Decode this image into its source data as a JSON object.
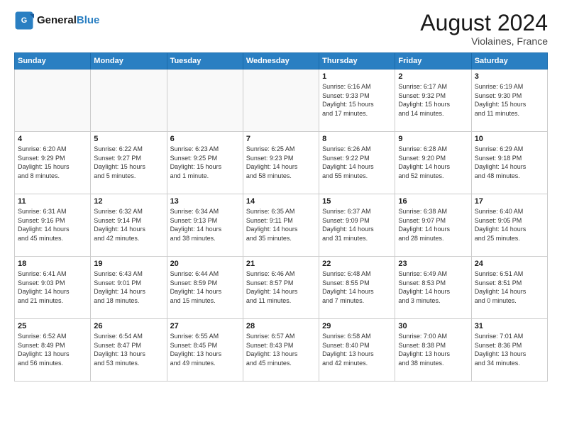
{
  "header": {
    "logo_line1": "General",
    "logo_line2": "Blue",
    "month_title": "August 2024",
    "location": "Violaines, France"
  },
  "days_of_week": [
    "Sunday",
    "Monday",
    "Tuesday",
    "Wednesday",
    "Thursday",
    "Friday",
    "Saturday"
  ],
  "weeks": [
    [
      {
        "day": "",
        "info": ""
      },
      {
        "day": "",
        "info": ""
      },
      {
        "day": "",
        "info": ""
      },
      {
        "day": "",
        "info": ""
      },
      {
        "day": "1",
        "info": "Sunrise: 6:16 AM\nSunset: 9:33 PM\nDaylight: 15 hours\nand 17 minutes."
      },
      {
        "day": "2",
        "info": "Sunrise: 6:17 AM\nSunset: 9:32 PM\nDaylight: 15 hours\nand 14 minutes."
      },
      {
        "day": "3",
        "info": "Sunrise: 6:19 AM\nSunset: 9:30 PM\nDaylight: 15 hours\nand 11 minutes."
      }
    ],
    [
      {
        "day": "4",
        "info": "Sunrise: 6:20 AM\nSunset: 9:29 PM\nDaylight: 15 hours\nand 8 minutes."
      },
      {
        "day": "5",
        "info": "Sunrise: 6:22 AM\nSunset: 9:27 PM\nDaylight: 15 hours\nand 5 minutes."
      },
      {
        "day": "6",
        "info": "Sunrise: 6:23 AM\nSunset: 9:25 PM\nDaylight: 15 hours\nand 1 minute."
      },
      {
        "day": "7",
        "info": "Sunrise: 6:25 AM\nSunset: 9:23 PM\nDaylight: 14 hours\nand 58 minutes."
      },
      {
        "day": "8",
        "info": "Sunrise: 6:26 AM\nSunset: 9:22 PM\nDaylight: 14 hours\nand 55 minutes."
      },
      {
        "day": "9",
        "info": "Sunrise: 6:28 AM\nSunset: 9:20 PM\nDaylight: 14 hours\nand 52 minutes."
      },
      {
        "day": "10",
        "info": "Sunrise: 6:29 AM\nSunset: 9:18 PM\nDaylight: 14 hours\nand 48 minutes."
      }
    ],
    [
      {
        "day": "11",
        "info": "Sunrise: 6:31 AM\nSunset: 9:16 PM\nDaylight: 14 hours\nand 45 minutes."
      },
      {
        "day": "12",
        "info": "Sunrise: 6:32 AM\nSunset: 9:14 PM\nDaylight: 14 hours\nand 42 minutes."
      },
      {
        "day": "13",
        "info": "Sunrise: 6:34 AM\nSunset: 9:13 PM\nDaylight: 14 hours\nand 38 minutes."
      },
      {
        "day": "14",
        "info": "Sunrise: 6:35 AM\nSunset: 9:11 PM\nDaylight: 14 hours\nand 35 minutes."
      },
      {
        "day": "15",
        "info": "Sunrise: 6:37 AM\nSunset: 9:09 PM\nDaylight: 14 hours\nand 31 minutes."
      },
      {
        "day": "16",
        "info": "Sunrise: 6:38 AM\nSunset: 9:07 PM\nDaylight: 14 hours\nand 28 minutes."
      },
      {
        "day": "17",
        "info": "Sunrise: 6:40 AM\nSunset: 9:05 PM\nDaylight: 14 hours\nand 25 minutes."
      }
    ],
    [
      {
        "day": "18",
        "info": "Sunrise: 6:41 AM\nSunset: 9:03 PM\nDaylight: 14 hours\nand 21 minutes."
      },
      {
        "day": "19",
        "info": "Sunrise: 6:43 AM\nSunset: 9:01 PM\nDaylight: 14 hours\nand 18 minutes."
      },
      {
        "day": "20",
        "info": "Sunrise: 6:44 AM\nSunset: 8:59 PM\nDaylight: 14 hours\nand 15 minutes."
      },
      {
        "day": "21",
        "info": "Sunrise: 6:46 AM\nSunset: 8:57 PM\nDaylight: 14 hours\nand 11 minutes."
      },
      {
        "day": "22",
        "info": "Sunrise: 6:48 AM\nSunset: 8:55 PM\nDaylight: 14 hours\nand 7 minutes."
      },
      {
        "day": "23",
        "info": "Sunrise: 6:49 AM\nSunset: 8:53 PM\nDaylight: 14 hours\nand 3 minutes."
      },
      {
        "day": "24",
        "info": "Sunrise: 6:51 AM\nSunset: 8:51 PM\nDaylight: 14 hours\nand 0 minutes."
      }
    ],
    [
      {
        "day": "25",
        "info": "Sunrise: 6:52 AM\nSunset: 8:49 PM\nDaylight: 13 hours\nand 56 minutes."
      },
      {
        "day": "26",
        "info": "Sunrise: 6:54 AM\nSunset: 8:47 PM\nDaylight: 13 hours\nand 53 minutes."
      },
      {
        "day": "27",
        "info": "Sunrise: 6:55 AM\nSunset: 8:45 PM\nDaylight: 13 hours\nand 49 minutes."
      },
      {
        "day": "28",
        "info": "Sunrise: 6:57 AM\nSunset: 8:43 PM\nDaylight: 13 hours\nand 45 minutes."
      },
      {
        "day": "29",
        "info": "Sunrise: 6:58 AM\nSunset: 8:40 PM\nDaylight: 13 hours\nand 42 minutes."
      },
      {
        "day": "30",
        "info": "Sunrise: 7:00 AM\nSunset: 8:38 PM\nDaylight: 13 hours\nand 38 minutes."
      },
      {
        "day": "31",
        "info": "Sunrise: 7:01 AM\nSunset: 8:36 PM\nDaylight: 13 hours\nand 34 minutes."
      }
    ]
  ]
}
